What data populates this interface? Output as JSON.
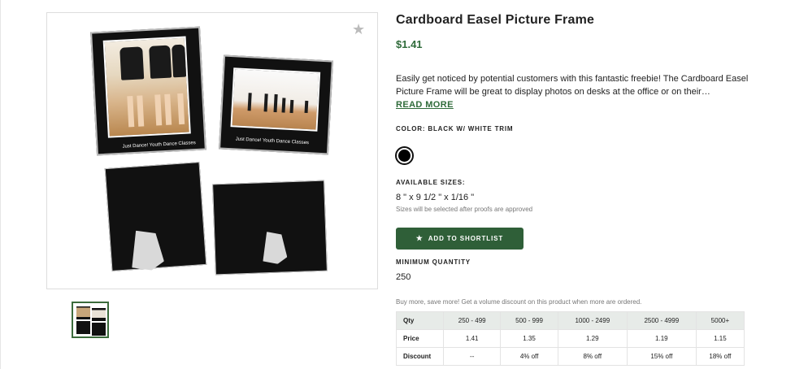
{
  "product": {
    "title": "Cardboard Easel Picture Frame",
    "price": "$1.41",
    "description": "Easily get noticed by potential customers with this fantastic freebie! The Cardboard Easel Picture Frame will be great to display photos on desks at the office or on their…",
    "read_more": "READ MORE"
  },
  "image": {
    "caption_1": "Just Dance! Youth Dance Classes",
    "caption_2": "Just Dance! Youth Dance Classes",
    "favorite_icon": "star-icon"
  },
  "color": {
    "label": "COLOR: BLACK W/ WHITE TRIM",
    "swatch_color": "#000000"
  },
  "sizes": {
    "label": "AVAILABLE SIZES:",
    "value": "8 \" x 9 1/2 \" x 1/16 \"",
    "note": "Sizes will be selected after proofs are approved"
  },
  "shortlist": {
    "label": "ADD TO SHORTLIST",
    "icon": "star-icon"
  },
  "minimum": {
    "label": "MINIMUM QUANTITY",
    "value": "250"
  },
  "volume_note": "Buy more, save more! Get a volume discount on this product when more are ordered.",
  "pricing": {
    "headers": [
      "Qty",
      "250 - 499",
      "500 - 999",
      "1000 - 2499",
      "2500 - 4999",
      "5000+"
    ],
    "rows": [
      [
        "Price",
        "1.41",
        "1.35",
        "1.29",
        "1.19",
        "1.15"
      ],
      [
        "Discount",
        "--",
        "4% off",
        "8% off",
        "15% off",
        "18% off"
      ]
    ]
  },
  "colors": {
    "accent": "#2f6b3a",
    "button": "#2f5f38"
  }
}
